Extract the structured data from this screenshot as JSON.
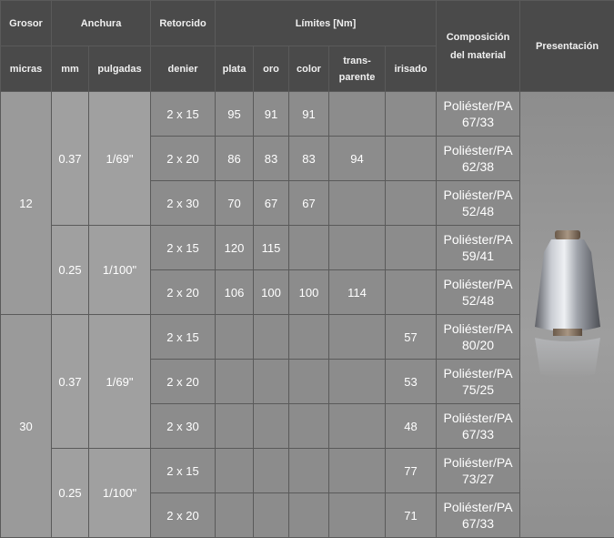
{
  "header": {
    "grosor": "Grosor",
    "anchura": "Anchura",
    "retorcido": "Retorcido",
    "limites": "Límites [Nm]",
    "composicion": "Composición del material",
    "presentacion": "Presentación",
    "micras": "micras",
    "mm": "mm",
    "pulgadas": "pulgadas",
    "denier": "denier",
    "plata": "plata",
    "oro": "oro",
    "color": "color",
    "transparente": "trans-parente",
    "irisado": "irisado"
  },
  "groups": [
    {
      "grosor": "12",
      "widths": [
        {
          "mm": "0.37",
          "pulgadas": "1/69\"",
          "rows": [
            {
              "denier": "2 x 15",
              "plata": "95",
              "oro": "91",
              "color": "91",
              "trans": "",
              "irisado": "",
              "comp": "Poliéster/PA 67/33"
            },
            {
              "denier": "2 x 20",
              "plata": "86",
              "oro": "83",
              "color": "83",
              "trans": "94",
              "irisado": "",
              "comp": "Poliéster/PA 62/38"
            },
            {
              "denier": "2 x 30",
              "plata": "70",
              "oro": "67",
              "color": "67",
              "trans": "",
              "irisado": "",
              "comp": "Poliéster/PA 52/48"
            }
          ]
        },
        {
          "mm": "0.25",
          "pulgadas": "1/100\"",
          "rows": [
            {
              "denier": "2 x 15",
              "plata": "120",
              "oro": "115",
              "color": "",
              "trans": "",
              "irisado": "",
              "comp": "Poliéster/PA 59/41"
            },
            {
              "denier": "2 x 20",
              "plata": "106",
              "oro": "100",
              "color": "100",
              "trans": "114",
              "irisado": "",
              "comp": "Poliéster/PA 52/48"
            }
          ]
        }
      ]
    },
    {
      "grosor": "30",
      "widths": [
        {
          "mm": "0.37",
          "pulgadas": "1/69\"",
          "rows": [
            {
              "denier": "2 x 15",
              "plata": "",
              "oro": "",
              "color": "",
              "trans": "",
              "irisado": "57",
              "comp": "Poliéster/PA 80/20"
            },
            {
              "denier": "2 x 20",
              "plata": "",
              "oro": "",
              "color": "",
              "trans": "",
              "irisado": "53",
              "comp": "Poliéster/PA 75/25"
            },
            {
              "denier": "2 x 30",
              "plata": "",
              "oro": "",
              "color": "",
              "trans": "",
              "irisado": "48",
              "comp": "Poliéster/PA 67/33"
            }
          ]
        },
        {
          "mm": "0.25",
          "pulgadas": "1/100\"",
          "rows": [
            {
              "denier": "2 x 15",
              "plata": "",
              "oro": "",
              "color": "",
              "trans": "",
              "irisado": "77",
              "comp": "Poliéster/PA 73/27"
            },
            {
              "denier": "2 x 20",
              "plata": "",
              "oro": "",
              "color": "",
              "trans": "",
              "irisado": "71",
              "comp": "Poliéster/PA 67/33"
            }
          ]
        }
      ]
    }
  ],
  "image": {
    "icon": "thread-spool-icon"
  }
}
